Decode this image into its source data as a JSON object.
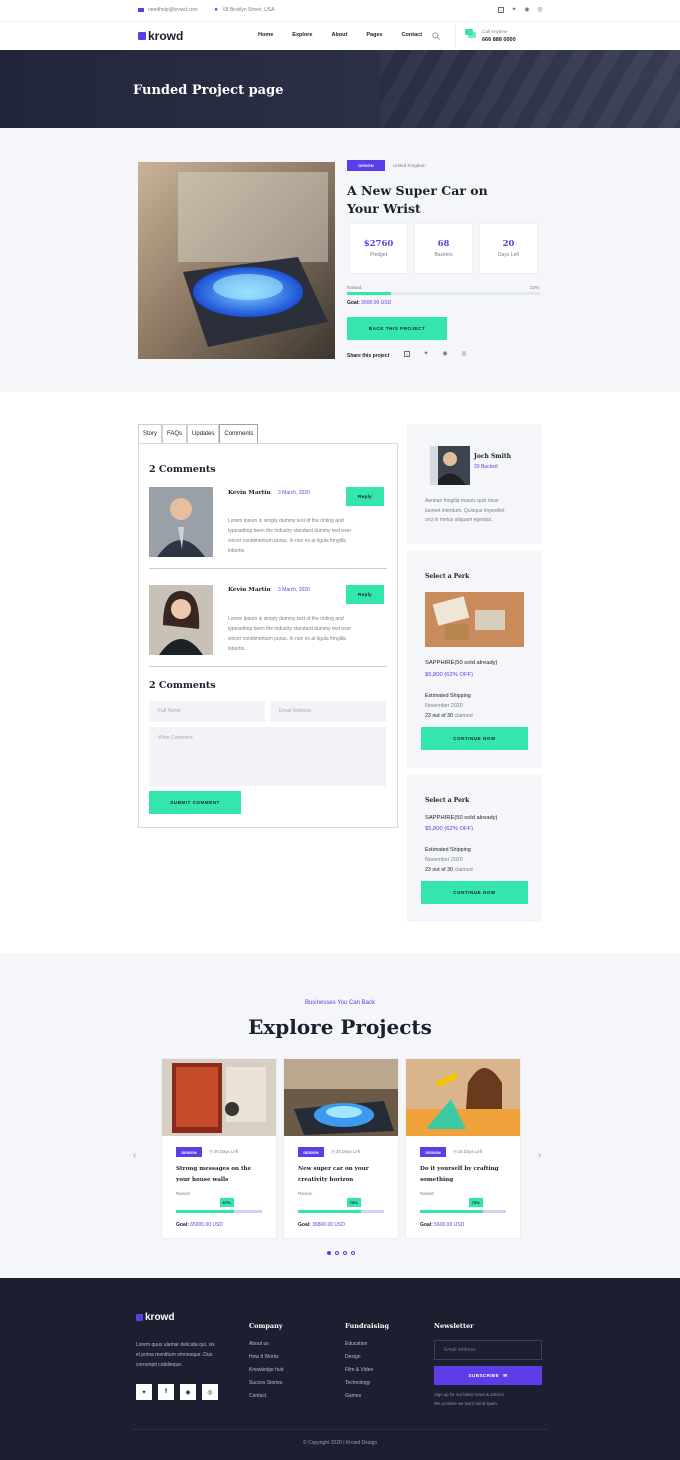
{
  "topbar": {
    "email": "needhelp@krowd.com",
    "address": "68 Broklyn Street, USA"
  },
  "brand": {
    "name": "krowd"
  },
  "nav": {
    "items": [
      "Home",
      "Explore",
      "About",
      "Pages",
      "Contact"
    ],
    "call_label": "Call Anytime",
    "call_number": "666 888 0000"
  },
  "hero": {
    "title": "Funded Project page"
  },
  "project": {
    "tag": "DESIGN",
    "location": "United Kingdom",
    "title_line1": "A New Super Car on",
    "title_line2": "Your Wrist",
    "stats": [
      {
        "value": "$2760",
        "label": "Pledget"
      },
      {
        "value": "68",
        "label": "Backers"
      },
      {
        "value": "20",
        "label": "Days Left"
      }
    ],
    "raised_label": "Raised:",
    "raised_pct": "23%",
    "raised_fraction": 0.23,
    "goal_label": "Goal:",
    "goal_value": "3600.00 USD",
    "back_button": "BACK THIS PROJECT",
    "share_label": "Share this project"
  },
  "tabs": [
    "Story",
    "FAQs",
    "Updates",
    "Comments"
  ],
  "comments": {
    "heading": "2 Comments",
    "items": [
      {
        "name": "Kevin Martin",
        "date": "3 March, 2020",
        "reply": "Reply",
        "text_line1": "Lorem Ipsum is simply dummy text of the rinting and",
        "text_line2": "typesetting been the industry standard dummy text ever",
        "text_line3": "sincer condimentum purus. In non ex at ligula fringilla",
        "text_line4": "lobortis."
      },
      {
        "name": "Kevin Martin",
        "date": "3 March, 2020",
        "reply": "Reply",
        "text_line1": "Lorem Ipsum is simply dummy text of the rinting and",
        "text_line2": "typesetting been the industry standard dummy text ever",
        "text_line3": "sincer condimentum purus. In non ex at ligula fringilla",
        "text_line4": "lobortis."
      }
    ],
    "form_heading": "2 Comments",
    "name_placeholder": "Full Name",
    "email_placeholder": "Email Address",
    "comment_placeholder": "Write Comment",
    "submit": "SUBMIT COMMENT"
  },
  "author": {
    "name": "Joch Smith",
    "backed": "20 Backed",
    "bio_line1": "Aenean fringilla mauris quis risus",
    "bio_line2": "laoreet interdum. Quisque imperdiet",
    "bio_line3": "orci in metus aliquam egestas."
  },
  "perks": [
    {
      "heading": "Select a Perk",
      "name": "SAPPHIRE(50 sold already)",
      "price": "$5,800 (62% OFF)",
      "ship_label": "Estimated Shipping",
      "ship_date": "November 2020",
      "claimed_count": "23 out of 30",
      "claimed_word": "claimed",
      "button": "CONTINUE NOW"
    },
    {
      "heading": "Select a Perk",
      "name": "SAPPHIRE(50 sold already)",
      "price": "$5,800 (62% OFF)",
      "ship_label": "Estimated Shipping",
      "ship_date": "November 2020",
      "claimed_count": "23 out of 30",
      "claimed_word": "claimed",
      "button": "CONTINUE NOW"
    }
  ],
  "explore": {
    "kicker": "Businesses You Can Back",
    "heading": "Explore Projects",
    "cards": [
      {
        "tag": "DESIGN",
        "days": "26 Days Left",
        "title_line1": "Strong messages on the",
        "title_line2": "your house walls",
        "raised": "Raised:",
        "pct": "67%",
        "fraction": 0.67,
        "goal_label": "Goal:",
        "goal": "65000.00 USD"
      },
      {
        "tag": "DESIGN",
        "days": "25 Days Left",
        "title_line1": "New super car on your",
        "title_line2": "creativity horizon",
        "raised": "Raised:",
        "pct": "73%",
        "fraction": 0.73,
        "goal_label": "Goal:",
        "goal": "36800.00 USD"
      },
      {
        "tag": "DESIGN",
        "days": "25 Days Left",
        "title_line1": "Do it yourself by crafting",
        "title_line2": "something",
        "raised": "Raised:",
        "pct": "73%",
        "fraction": 0.73,
        "goal_label": "Goal:",
        "goal": "5600.00 USD"
      }
    ]
  },
  "footer": {
    "about_line1": "Lorem quus ulamar delicata qui, vix",
    "about_line2": "ei prima mentitum omnesque. Duo",
    "about_line3": "corrumpit cotidieque.",
    "company_heading": "Company",
    "company_links": [
      "About us",
      "How It Works",
      "Knowledge hub",
      "Succes Stories",
      "Contact"
    ],
    "fund_heading": "Fundraising",
    "fund_links": [
      "Education",
      "Design",
      "Film & Video",
      "Technology",
      "Games"
    ],
    "news_heading": "Newsletter",
    "email_placeholder": "Email address",
    "subscribe": "SUBSCRIBE",
    "note_line1": "Sign up for our latest news & articles.",
    "note_line2": "We promise we won't send spam.",
    "copyright": "© Copyright 2020 | Krowd Design"
  },
  "colors": {
    "accent": "#5c3ee8",
    "green": "#34e6ad",
    "dark": "#1c1f30"
  }
}
